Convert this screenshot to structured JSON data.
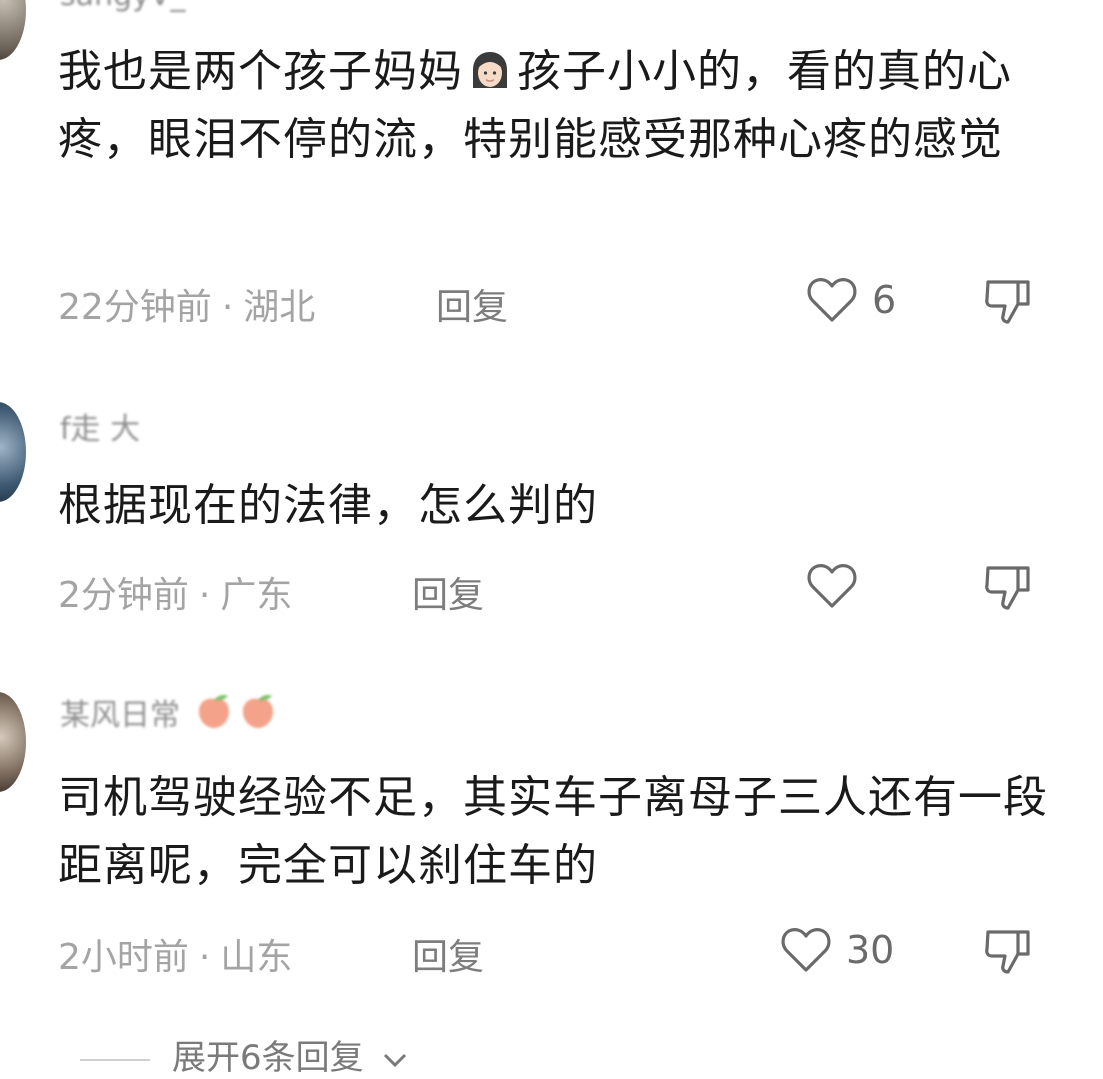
{
  "comments": [
    {
      "username": "sangyV_",
      "text_part1": "我也是两个孩子妈妈",
      "text_part2": "孩子小小的，看的真的心疼，眼泪不停的流，特别能感受那种心疼的感觉",
      "time": "22分钟前",
      "location": "湖北",
      "reply_label": "回复",
      "likes": "6"
    },
    {
      "username": "f走 大",
      "text": "根据现在的法律，怎么判的",
      "time": "2分钟前",
      "location": "广东",
      "reply_label": "回复",
      "likes": ""
    },
    {
      "username": "某风日常",
      "text": "司机驾驶经验不足，其实车子离母子三人还有一段距离呢，完全可以刹住车的",
      "time": "2小时前",
      "location": "山东",
      "reply_label": "回复",
      "likes": "30"
    }
  ],
  "separator": "·",
  "expand_label": "展开6条回复",
  "icons": {
    "like": "heart-outline-icon",
    "dislike": "thumbs-down-icon",
    "expand": "chevron-down-icon"
  }
}
